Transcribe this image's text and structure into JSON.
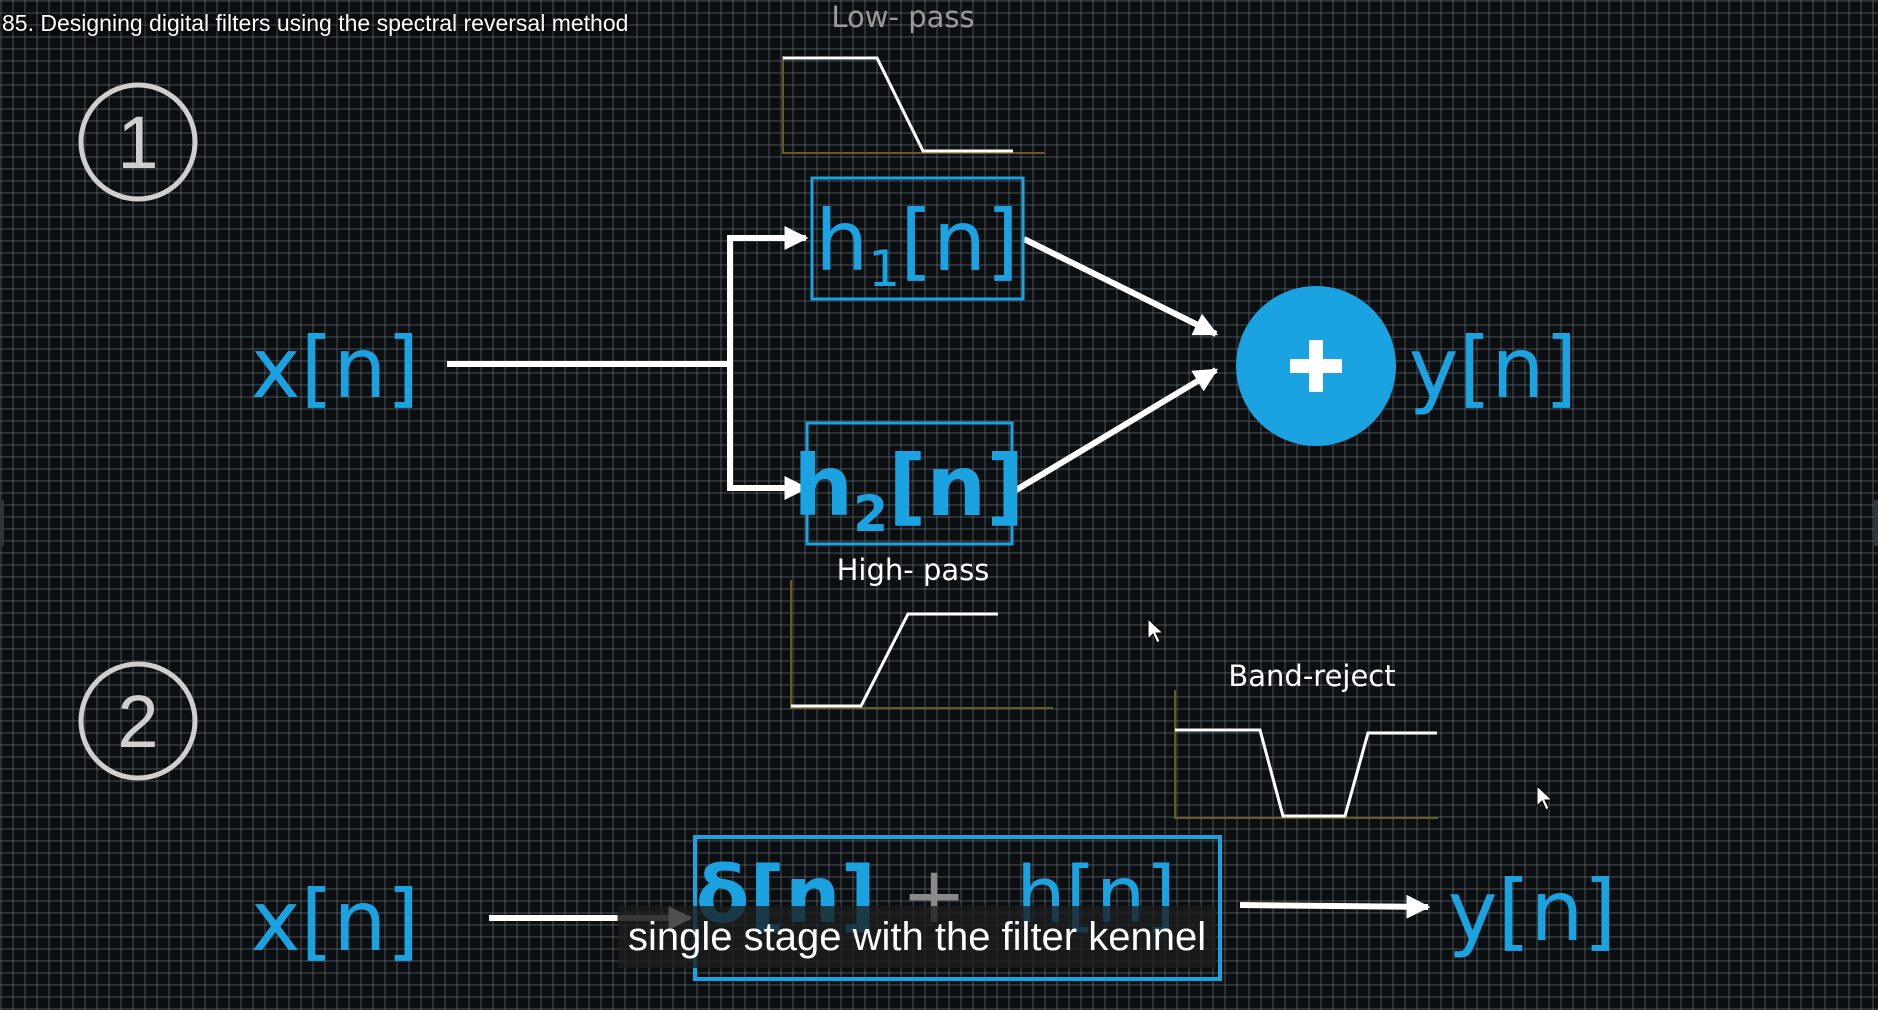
{
  "title": "85. Designing digital filters using the spectral reversal method",
  "caption": "single stage with the filter kennel",
  "colors": {
    "accent": "#1aa3e0",
    "wire": "#ffffff",
    "step_number": "#cfcfcf",
    "response_axis": "#6b5a20"
  },
  "diagram": {
    "stage1": {
      "number": "1",
      "input": "x[n]",
      "filter1": {
        "base": "h",
        "sub": "1",
        "arg": "[n]"
      },
      "filter2": {
        "base": "h",
        "sub": "2",
        "arg": "[n]"
      },
      "adder_icon": "plus-icon",
      "output": "y[n]",
      "lowpass_label": "Low- pass",
      "highpass_label": "High- pass"
    },
    "stage2": {
      "number": "2",
      "input": "x[n]",
      "kernel_delta": "δ[n]",
      "kernel_op": "+",
      "kernel_h": "h[n]",
      "output": "y[n]",
      "bandreject_label": "Band-reject"
    }
  },
  "cursor_icons": [
    "mouse-pointer-icon",
    "mouse-pointer-icon"
  ]
}
